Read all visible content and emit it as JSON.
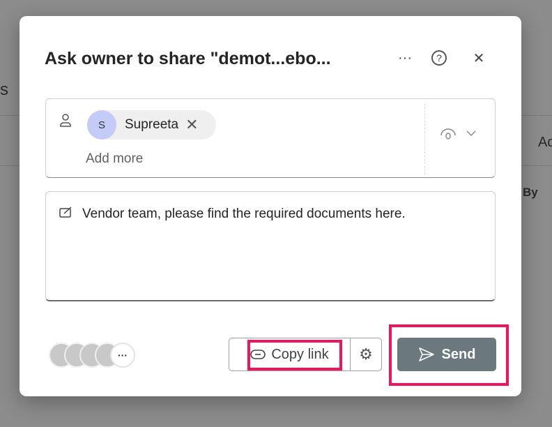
{
  "background": {
    "frag1": "s",
    "frag2": "Ad",
    "frag3": "By"
  },
  "dialog": {
    "title": "Ask owner to share \"demot...ebo...",
    "more_label": "···",
    "help_label": "?",
    "close_label": "✕",
    "recipient": {
      "initial": "S",
      "name": "Supreeta",
      "remove_label": "✕"
    },
    "add_more_placeholder": "Add more",
    "message": "Vendor team, please find the required documents here.",
    "avatars_more": "···",
    "copy_link_label": "Copy link",
    "send_label": "Send"
  },
  "colors": {
    "highlight": "#f0145a",
    "send": "#6b787d"
  }
}
